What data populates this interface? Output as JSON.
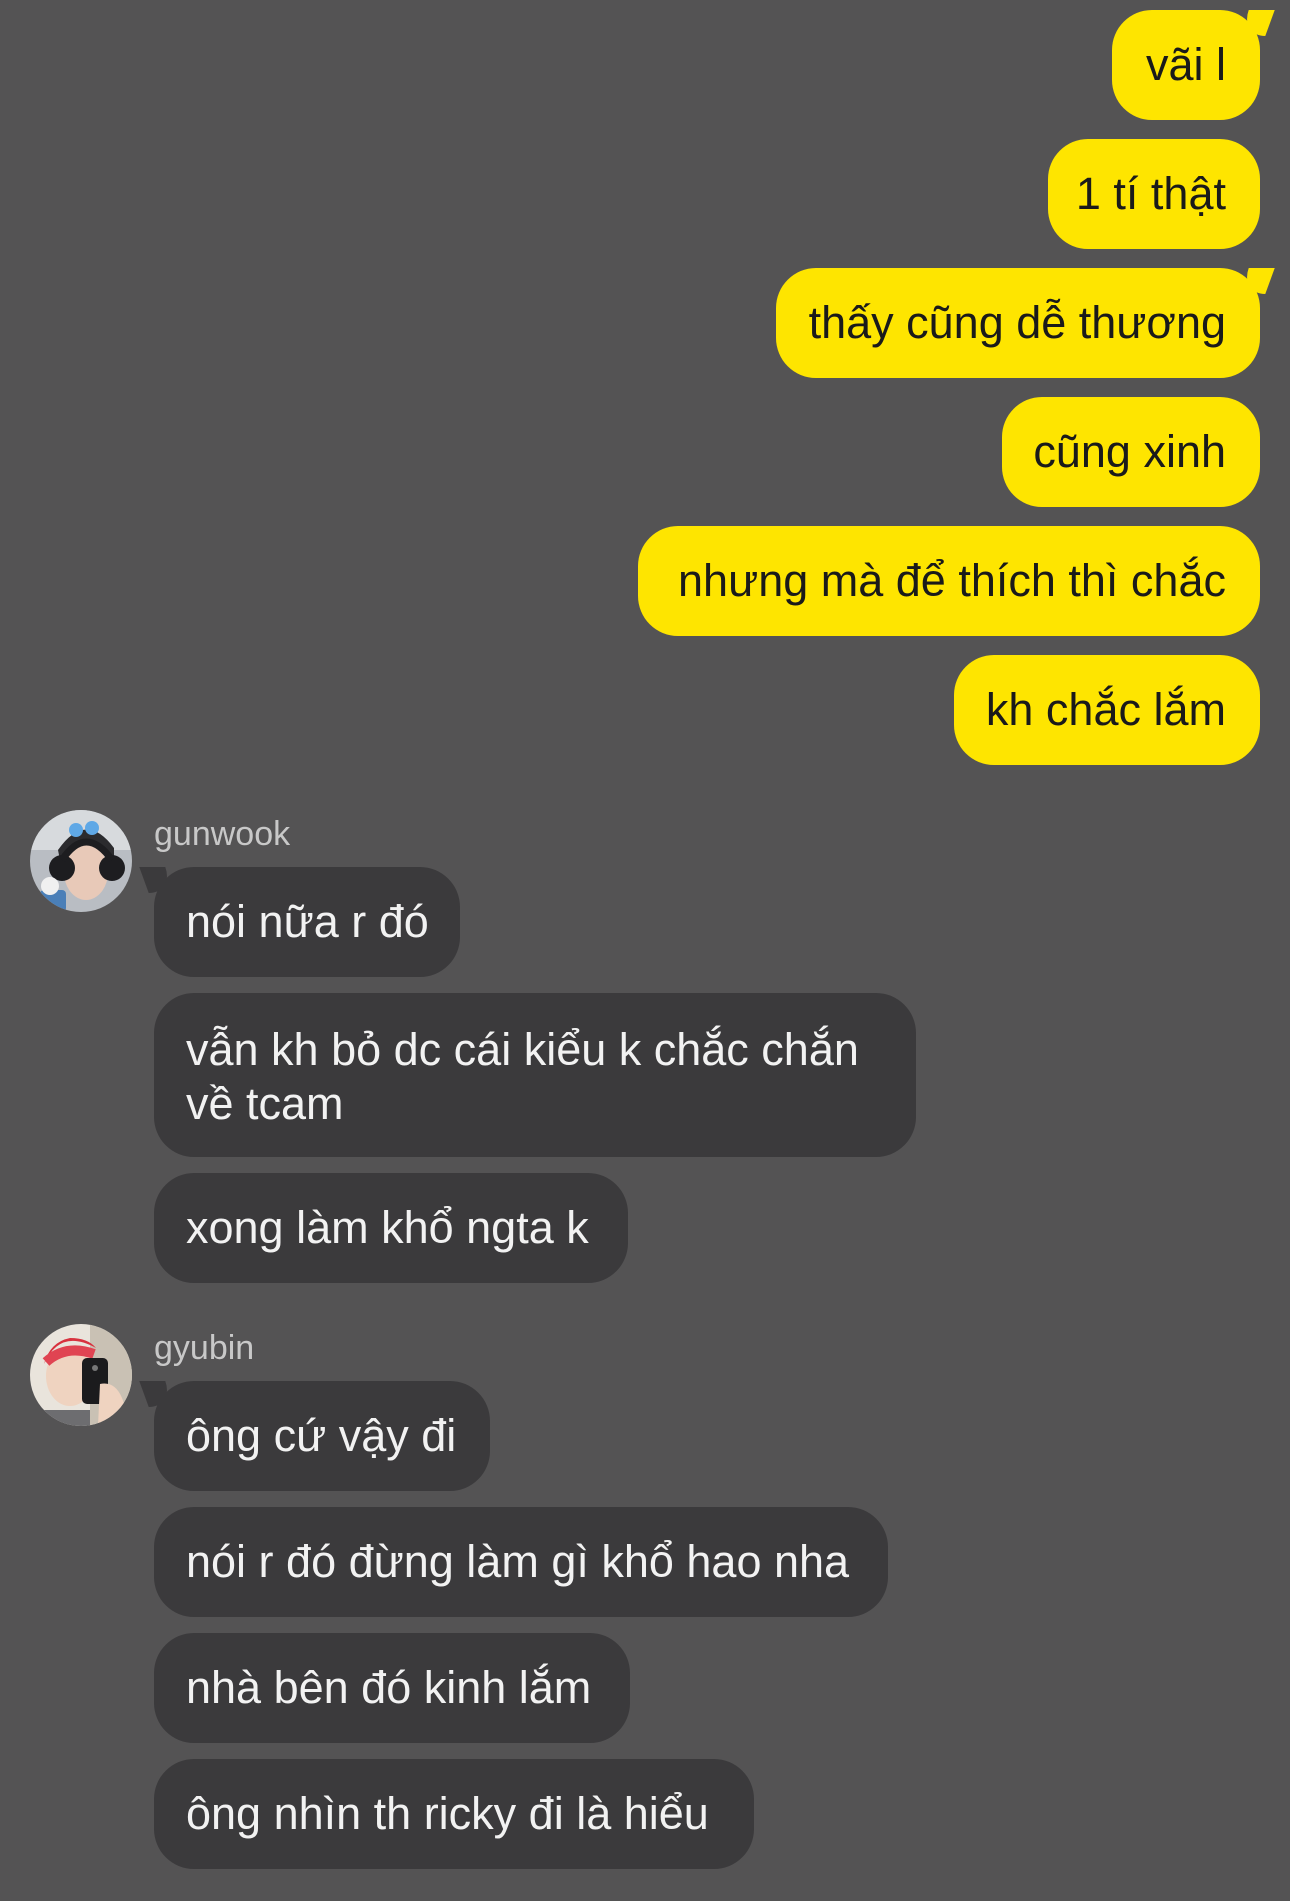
{
  "colors": {
    "background": "#545354",
    "my_bubble": "#fee500",
    "their_bubble": "#3b3a3c"
  },
  "messages_sent": [
    "vãi l",
    "1 tí thật",
    "thấy cũng dễ thương",
    "cũng xinh",
    "nhưng mà để thích thì chắc",
    "kh chắc lắm"
  ],
  "groups": [
    {
      "sender": "gunwook",
      "avatar": "person-avatar-headphones",
      "messages": [
        "nói nữa r đó",
        "vẫn kh bỏ dc cái kiểu k chắc chắn về tcam",
        "xong làm khổ ngta k"
      ]
    },
    {
      "sender": "gyubin",
      "avatar": "person-avatar-red-hair-selfie",
      "messages": [
        "ông cứ vậy đi",
        "nói r đó đừng làm gì khổ hao nha",
        "nhà bên đó kinh lắm",
        "ông nhìn th ricky đi là hiểu"
      ]
    }
  ]
}
